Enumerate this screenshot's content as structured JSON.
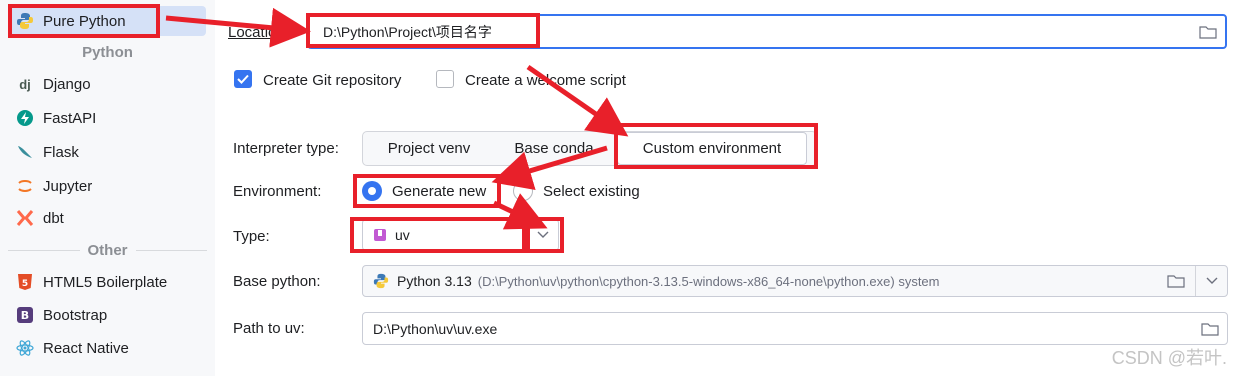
{
  "sidebar": {
    "items_top": [
      {
        "label": "Pure Python",
        "icon": "python-icon",
        "selected": true
      }
    ],
    "group_python": "Python",
    "python_items": [
      {
        "label": "Django",
        "icon": "django-icon"
      },
      {
        "label": "FastAPI",
        "icon": "fastapi-icon"
      },
      {
        "label": "Flask",
        "icon": "flask-icon"
      },
      {
        "label": "Jupyter",
        "icon": "jupyter-icon"
      },
      {
        "label": "dbt",
        "icon": "dbt-icon"
      }
    ],
    "group_other": "Other",
    "other_items": [
      {
        "label": "HTML5 Boilerplate",
        "icon": "html5-icon"
      },
      {
        "label": "Bootstrap",
        "icon": "bootstrap-icon"
      },
      {
        "label": "React Native",
        "icon": "react-icon"
      }
    ]
  },
  "form": {
    "location_label": "Location:",
    "location_value": "D:\\Python\\Project\\项目名字",
    "git_checkbox_label": "Create Git repository",
    "git_checked": true,
    "welcome_checkbox_label": "Create a welcome script",
    "welcome_checked": false,
    "interpreter_label": "Interpreter type:",
    "interpreter_options": [
      "Project venv",
      "Base conda",
      "Custom environment"
    ],
    "interpreter_selected": "Custom environment",
    "environment_label": "Environment:",
    "env_generate": "Generate new",
    "env_existing": "Select existing",
    "type_label": "Type:",
    "type_value": "uv",
    "base_python_label": "Base python:",
    "base_python_name": "Python 3.13",
    "base_python_path": "(D:\\Python\\uv\\python\\cpython-3.13.5-windows-x86_64-none\\python.exe) system",
    "uv_path_label": "Path to uv:",
    "uv_path_value": "D:\\Python\\uv\\uv.exe"
  },
  "watermark": "CSDN @若叶.",
  "colors": {
    "accent": "#3574f0",
    "annotation": "#e8202a",
    "selected_bg": "#d5e1f7"
  }
}
